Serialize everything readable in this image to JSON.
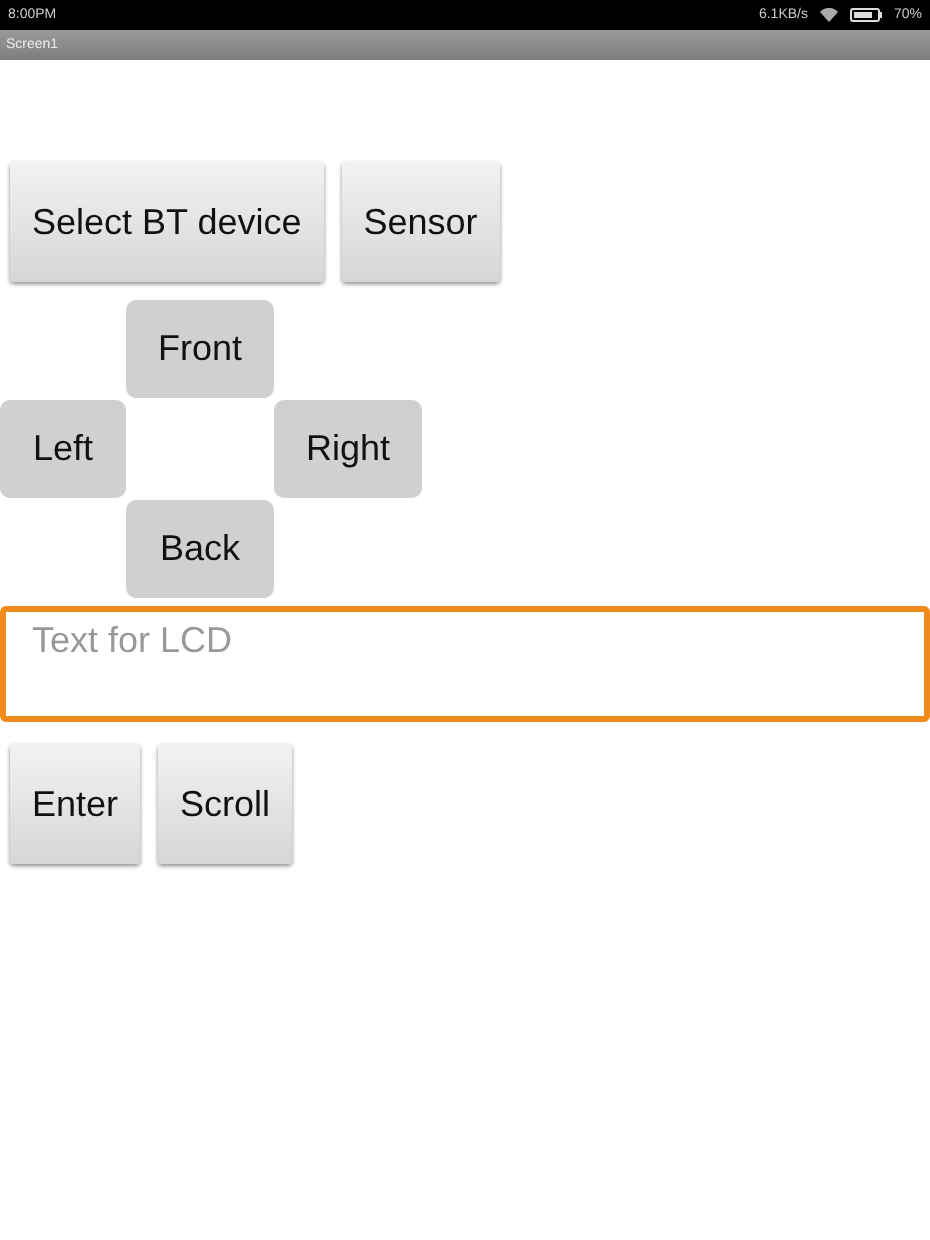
{
  "status_bar": {
    "time": "8:00PM",
    "speed": "6.1KB/s",
    "battery": "70%"
  },
  "title_bar": {
    "title": "Screen1"
  },
  "top_buttons": [
    "Select BT device",
    "Sensor"
  ],
  "direction_pad": {
    "front": "Front",
    "left": "Left",
    "right": "Right",
    "back": "Back"
  },
  "lcd_field": {
    "placeholder": "Text for LCD"
  },
  "bottom_buttons": [
    "Enter",
    "Scroll"
  ]
}
